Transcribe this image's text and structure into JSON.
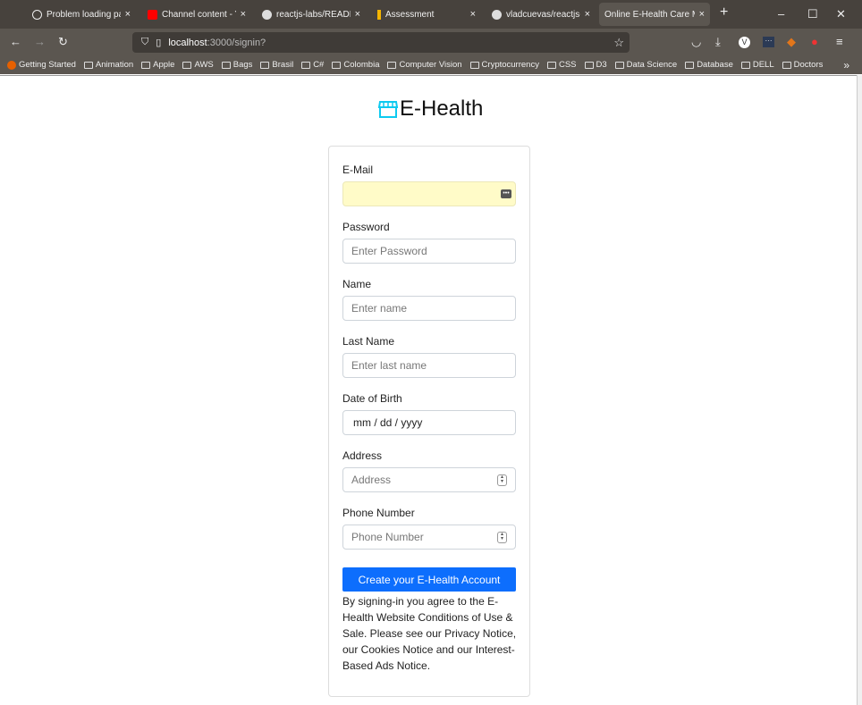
{
  "browser": {
    "tabs": [
      {
        "label": "Problem loading pag",
        "icon": "info-icon"
      },
      {
        "label": "Channel content - Yo",
        "icon": "youtube-icon"
      },
      {
        "label": "reactjs-labs/README",
        "icon": "github-icon"
      },
      {
        "label": "Assessment",
        "icon": "assessment-icon"
      },
      {
        "label": "vladcuevas/reactjs-lab",
        "icon": "github-icon"
      },
      {
        "label": "Online E-Health Care Ma",
        "icon": "none",
        "active": true
      }
    ],
    "url_host": "localhost",
    "url_path": ":3000/signin?",
    "bookmarks": [
      "Getting Started",
      "Animation",
      "Apple",
      "AWS",
      "Bags",
      "Brasil",
      "C#",
      "Colombia",
      "Computer Vision",
      "Cryptocurrency",
      "CSS",
      "D3",
      "Data Science",
      "Database",
      "DELL",
      "Doctors"
    ]
  },
  "app": {
    "title": "E-Health",
    "brand_color": "#0dcaf0"
  },
  "form": {
    "email_label": "E-Mail",
    "email_value": "",
    "password_label": "Password",
    "password_placeholder": "Enter Password",
    "name_label": "Name",
    "name_placeholder": "Enter name",
    "lastname_label": "Last Name",
    "lastname_placeholder": "Enter last name",
    "dob_label": "Date of Birth",
    "dob_placeholder": "mm / dd / yyyy",
    "address_label": "Address",
    "address_placeholder": "Address",
    "phone_label": "Phone Number",
    "phone_placeholder": "Phone Number",
    "submit_label": "Create your E-Health Account",
    "terms": "By signing-in you agree to the E-Health Website Conditions of Use & Sale. Please see our Privacy Notice, our Cookies Notice and our Interest-Based Ads Notice."
  }
}
